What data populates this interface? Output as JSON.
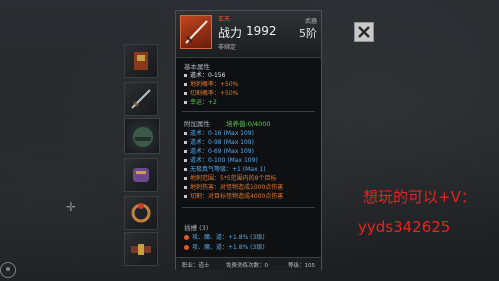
{
  "item": {
    "rarity": "玄天",
    "power_label": "战力",
    "power_value": "1992",
    "bind_status": "非绑定",
    "type": "武器",
    "tier": "5阶"
  },
  "base_attrs": {
    "title": "基本属性",
    "rows": [
      {
        "text": "道术：0-156"
      },
      {
        "text": "地刺概率：+50%"
      },
      {
        "text": "切割概率：+50%"
      },
      {
        "text": "幸运：+2"
      }
    ]
  },
  "extra_attrs": {
    "title": "附加属性",
    "cultivation": "培养值:0/4000",
    "rows": [
      {
        "text": "道术：0-16 (Max 109)"
      },
      {
        "text": "道术：0-98 (Max 109)"
      },
      {
        "text": "道术：0-69 (Max 109)"
      },
      {
        "text": "道术：0-100 (Max 109)"
      },
      {
        "text": "无极真气等级：+1 (Max 1)"
      },
      {
        "text": "地刺范围：5*5范围内的8个目标"
      },
      {
        "text": "地刺伤害：对怪物造成1000点伤害"
      },
      {
        "text": "切割：对目标怪物造成4000点伤害"
      }
    ]
  },
  "sockets": {
    "title": "插槽 (3)",
    "rows": [
      {
        "text": "攻、魔、道：+1.8% (3级)"
      },
      {
        "text": "攻、魔、道：+1.8% (3级)"
      }
    ]
  },
  "footer": {
    "class": "职业：道士",
    "free_wash": "免费洗练次数：0",
    "level": "等级：105"
  },
  "watermark": {
    "line1": "想玩的可以+V：",
    "line2": "yyds342625"
  },
  "colors": {
    "orange": "#e1782c",
    "green": "#5ecb4e",
    "blue": "#58a9e8",
    "watermark_red": "#e8231f"
  }
}
